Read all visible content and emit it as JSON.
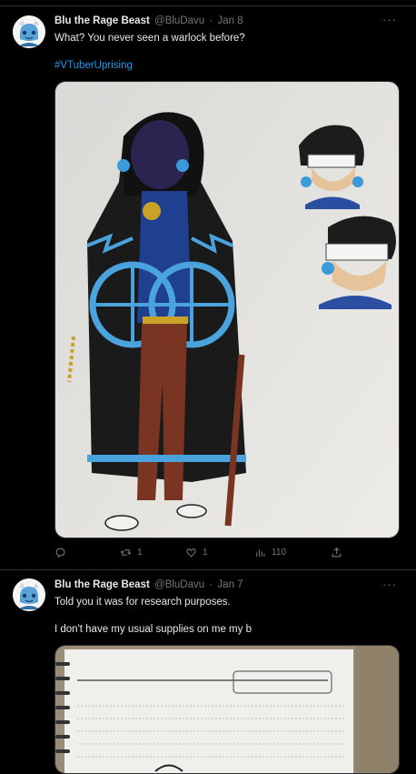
{
  "tweets": [
    {
      "author_name": "Blu the Rage Beast",
      "handle": "@BluDavu",
      "separator": "·",
      "date": "Jan 8",
      "text": "What? You never seen a warlock before?",
      "hashtag": "#VTuberUprising",
      "actions": {
        "reply_count": "",
        "retweet_count": "1",
        "like_count": "1",
        "views_count": "110"
      }
    },
    {
      "author_name": "Blu the Rage Beast",
      "handle": "@BluDavu",
      "separator": "·",
      "date": "Jan 7",
      "text": "Told you it was for research purposes.",
      "text2": "I  don't have my usual supplies on me my b"
    }
  ],
  "colors": {
    "background": "#000000",
    "text": "#e7e9ea",
    "muted": "#71767b",
    "link": "#1d9bf0",
    "divider": "#2f3336"
  },
  "icons": [
    "more-icon",
    "reply-icon",
    "retweet-icon",
    "like-icon",
    "views-icon",
    "share-icon"
  ]
}
